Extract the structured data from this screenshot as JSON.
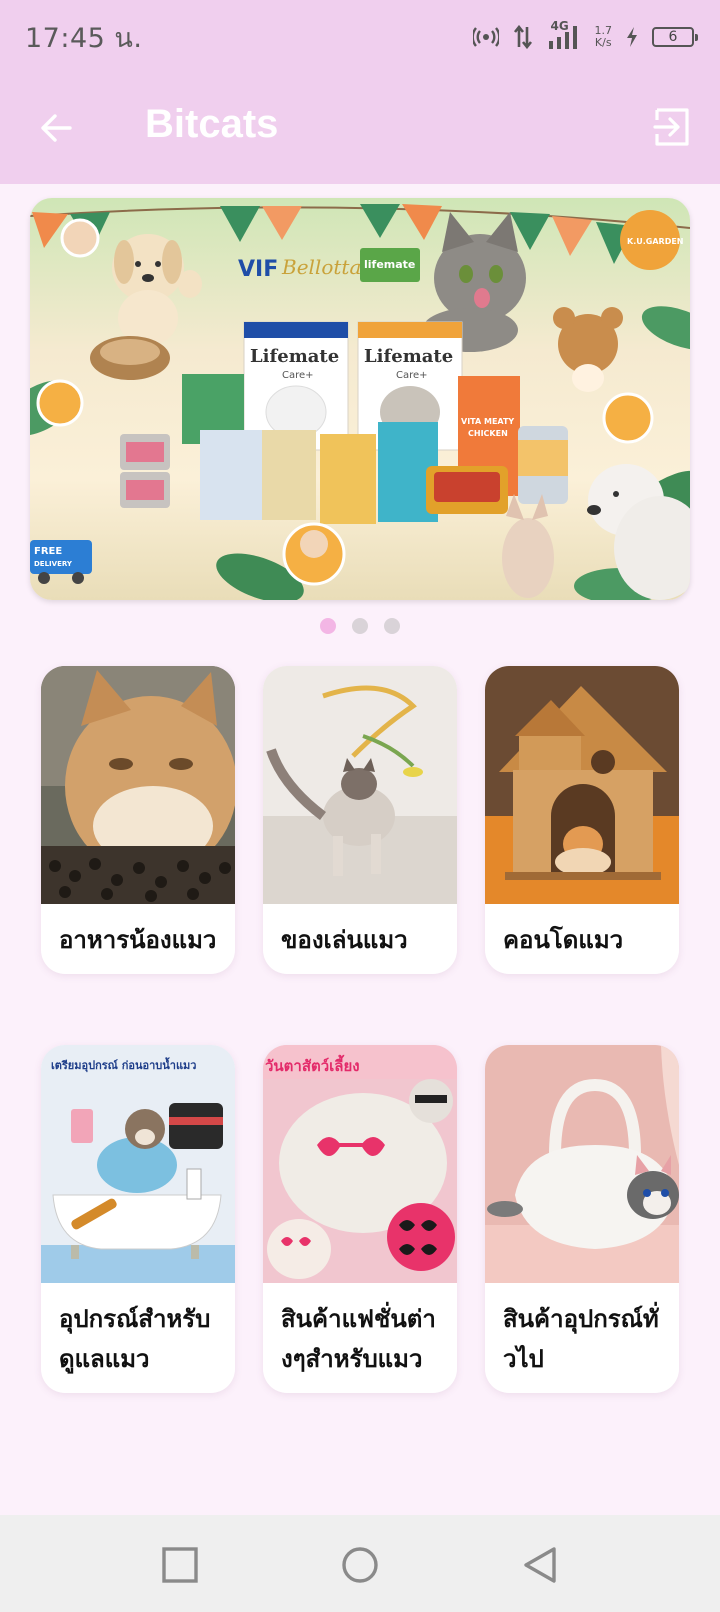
{
  "status_bar": {
    "time": "17:45 น.",
    "network": "4G",
    "speed_value": "1.7",
    "speed_unit": "K/s",
    "battery_level": "6",
    "icons": [
      "hotspot-icon",
      "data-transfer-icon",
      "signal-icon",
      "charging-icon",
      "battery-icon"
    ]
  },
  "app_bar": {
    "title": "Bitcats",
    "back_icon": "arrow-left-icon",
    "exit_icon": "logout-icon"
  },
  "banner": {
    "slide_count": 3,
    "active_slide": 1,
    "texts": {
      "brand1": "VIF",
      "brand2": "Bellotta",
      "brand3": "lifemate",
      "bag1": "Lifemate",
      "bag2": "Lifemate",
      "care": "Care+",
      "shop": "K.U.GARDEN",
      "free": "FREE",
      "delivery": "DELIVERY",
      "vita": "VITA MEATY",
      "chicken": "CHICKEN"
    }
  },
  "categories": [
    {
      "label": "อาหารน้องแมว"
    },
    {
      "label": "ของเล่นแมว"
    },
    {
      "label": "คอนโดแมว"
    },
    {
      "label": "อุปกรณ์สำหรับดูแลแมว"
    },
    {
      "label": "สินค้าแฟชั่นต่างๆสำหรับแมว"
    },
    {
      "label": "สินค้าอุปกรณ์ทั่วไป"
    }
  ],
  "card_image_texts": {
    "grooming": "เตรียมอุปกรณ์ ก่อนอาบน้ำแมว",
    "fashion": "วันตาสัตว์เลี้ยง"
  },
  "nav_bar": {
    "icons": [
      "recent-apps-icon",
      "home-icon",
      "back-triangle-icon"
    ]
  },
  "colors": {
    "header": "#f0cfee",
    "background": "#fcf1fb",
    "dot_active": "#f3b6e5",
    "dot_inactive": "#d9d3d8"
  }
}
